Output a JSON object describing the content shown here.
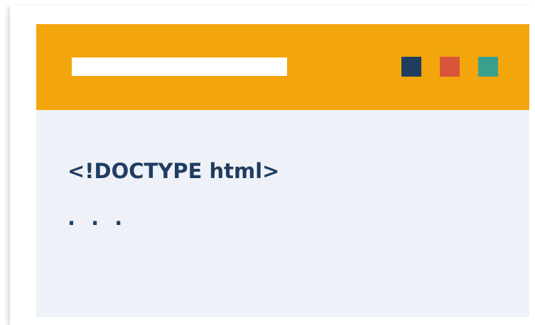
{
  "colors": {
    "titlebar": "#f2a60c",
    "address_bar": "#ffffff",
    "content_background": "#eef2f8",
    "text": "#1f3d5f"
  },
  "window_buttons": [
    {
      "icon": "square-icon",
      "color": "#1f3d5f"
    },
    {
      "icon": "square-icon",
      "color": "#d9553a"
    },
    {
      "icon": "square-icon",
      "color": "#3aa08e"
    }
  ],
  "content": {
    "lines": [
      "<!DOCTYPE html>",
      ". . ."
    ]
  }
}
